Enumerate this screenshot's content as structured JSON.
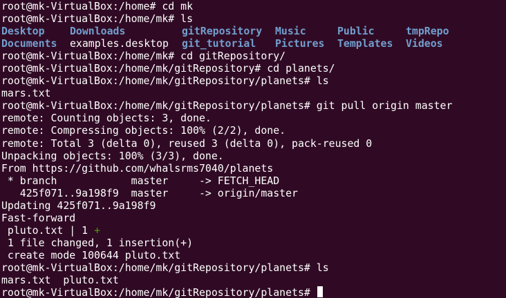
{
  "colors": {
    "background": "#300a24",
    "foreground": "#ffffff",
    "directory": "#729fcf",
    "diff_plus": "#4e9a06"
  },
  "terminal": {
    "l1": "root@mk-VirtualBox:/home# cd mk",
    "l2": "root@mk-VirtualBox:/home/mk# ls",
    "ls_row1": {
      "c1": "Desktop",
      "c2": "Downloads",
      "c3": "gitRepository",
      "c4": "Music",
      "c5": "Public",
      "c6": "tmpRepo"
    },
    "ls_row2": {
      "c1": "Documents",
      "c2": "examples.desktop",
      "c3": "git_tutorial",
      "c4": "Pictures",
      "c5": "Templates",
      "c6": "Videos"
    },
    "l5": "root@mk-VirtualBox:/home/mk# cd gitRepository/",
    "l6": "root@mk-VirtualBox:/home/mk/gitRepository# cd planets/",
    "l7": "root@mk-VirtualBox:/home/mk/gitRepository/planets# ls",
    "l8": "mars.txt",
    "l9": "root@mk-VirtualBox:/home/mk/gitRepository/planets# git pull origin master",
    "l10": "remote: Counting objects: 3, done.",
    "l11": "remote: Compressing objects: 100% (2/2), done.",
    "l12": "remote: Total 3 (delta 0), reused 3 (delta 0), pack-reused 0",
    "l13": "Unpacking objects: 100% (3/3), done.",
    "l14": "From https://github.com/whalsrms7040/planets",
    "l15": " * branch            master     -> FETCH_HEAD",
    "l16": "   425f071..9a198f9  master     -> origin/master",
    "l17": "Updating 425f071..9a198f9",
    "l18": "Fast-forward",
    "l19": " pluto.txt | 1 ",
    "l19_plus": "+",
    "l20": " 1 file changed, 1 insertion(+)",
    "l21": " create mode 100644 pluto.txt",
    "l22": "root@mk-VirtualBox:/home/mk/gitRepository/planets# ls",
    "l23": "mars.txt  pluto.txt",
    "l24": "root@mk-VirtualBox:/home/mk/gitRepository/planets# "
  }
}
